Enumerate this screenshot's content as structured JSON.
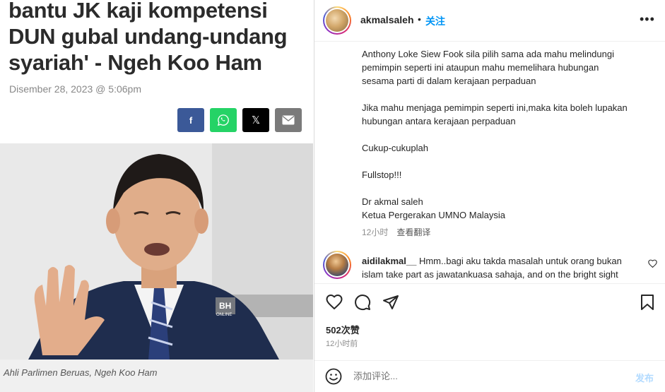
{
  "article": {
    "headline": "bantu JK kaji kompetensi\nDUN gubal undang-undang\nsyariah' - Ngeh Koo Ham",
    "date": "Disember 28, 2023 @ 5:06pm",
    "share": {
      "facebook": "f",
      "x": "𝕏"
    },
    "photo": {
      "watermark_top": "BH",
      "watermark_bottom": "ONLINE"
    },
    "caption": "Ahli Parlimen Beruas, Ngeh Koo Ham"
  },
  "post": {
    "username": "akmalsaleh",
    "separator": "•",
    "follow_label": "关注",
    "more_label": "•••",
    "caption": "Anthony Loke Siew Fook sila pilih sama ada mahu melindungi\npemimpin seperti ini ataupun mahu memelihara hubungan\nsesama parti di dalam kerajaan perpaduan\n\nJika mahu menjaga pemimpin seperti ini,maka kita boleh lupakan\nhubungan antara kerajaan perpaduan\n\nCukup-cukuplah\n\nFullstop!!!\n\nDr akmal saleh\nKetua Pergerakan UMNO Malaysia",
    "caption_time": "12小时",
    "translate_label": "查看翻译",
    "comment": {
      "username": "aidilakmal__",
      "text": " Hmm..bagi aku takda masalah untuk orang bukan islam take part as jawatankuasa sahaja, and on the bright sight"
    },
    "likes": "502次赞",
    "time": "12小时前",
    "add_comment_placeholder": "添加评论...",
    "post_label": "发布"
  },
  "colors": {
    "facebook": "#3b5998",
    "whatsapp": "#25d366",
    "x": "#000000",
    "email": "#7a7a7a",
    "follow": "#0095f6",
    "post_disabled": "#b3dbff"
  },
  "icons": [
    "facebook-icon",
    "whatsapp-icon",
    "x-icon",
    "email-icon",
    "more-icon",
    "heart-icon",
    "comment-icon",
    "share-icon",
    "bookmark-icon",
    "emoji-icon"
  ]
}
